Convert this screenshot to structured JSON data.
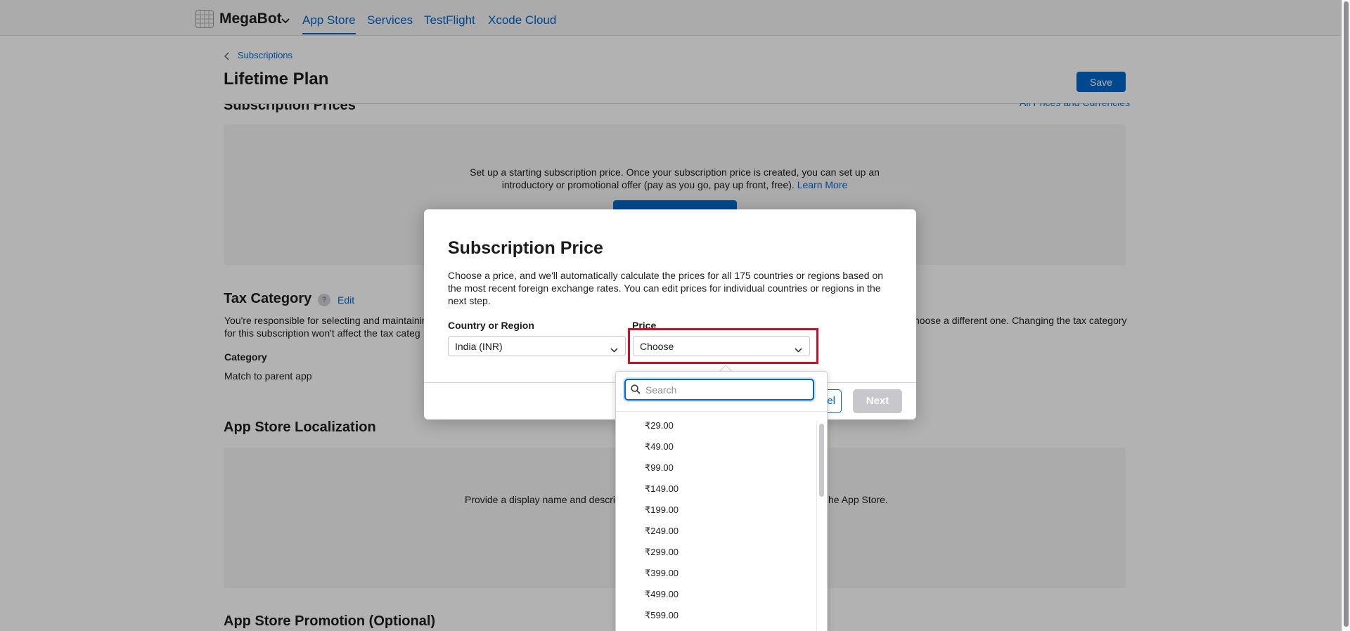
{
  "nav": {
    "brand": "MegaBot",
    "tabs": [
      {
        "label": "App Store",
        "active": true
      },
      {
        "label": "Services"
      },
      {
        "label": "TestFlight"
      },
      {
        "label": "Xcode Cloud"
      }
    ]
  },
  "page": {
    "breadcrumb": "Subscriptions",
    "title": "Lifetime Plan",
    "save_label": "Save"
  },
  "subscription_prices": {
    "title": "Subscription Prices",
    "link": "All Prices and Currencies",
    "text_line1": "Set up a starting subscription price. Once your subscription price is created, you can set up an",
    "text_line2": "introductory or promotional offer (pay as you go, pay up front, free).",
    "learn_more": "Learn More"
  },
  "tax": {
    "title": "Tax Category",
    "help": "?",
    "edit": "Edit",
    "desc_left_1": "You're responsible for selecting and maintaining",
    "desc_left_2": "for this subscription won't affect the tax categ",
    "desc_right": "hoose a different one. Changing the tax category",
    "category_label": "Category",
    "category_value": "Match to parent app"
  },
  "localization": {
    "title": "App Store Localization",
    "text_left": "Provide a display name and descrip",
    "text_right": "he App Store."
  },
  "promotion": {
    "title": "App Store Promotion (Optional)"
  },
  "modal": {
    "title": "Subscription Price",
    "description": "Choose a price, and we'll automatically calculate the prices for all 175 countries or regions based on the most recent foreign exchange rates. You can edit prices for individual countries or regions in the next step.",
    "country_label": "Country or Region",
    "country_value": "India (INR)",
    "price_label": "Price",
    "price_value": "Choose",
    "cancel_label": "Cancel",
    "cancel_visible": "cel",
    "next_label": "Next"
  },
  "dropdown": {
    "search_placeholder": "Search",
    "options": [
      "₹29.00",
      "₹49.00",
      "₹99.00",
      "₹149.00",
      "₹199.00",
      "₹249.00",
      "₹299.00",
      "₹399.00",
      "₹499.00",
      "₹599.00"
    ]
  },
  "colors": {
    "accent": "#0066cc",
    "highlight": "#e8001f"
  }
}
